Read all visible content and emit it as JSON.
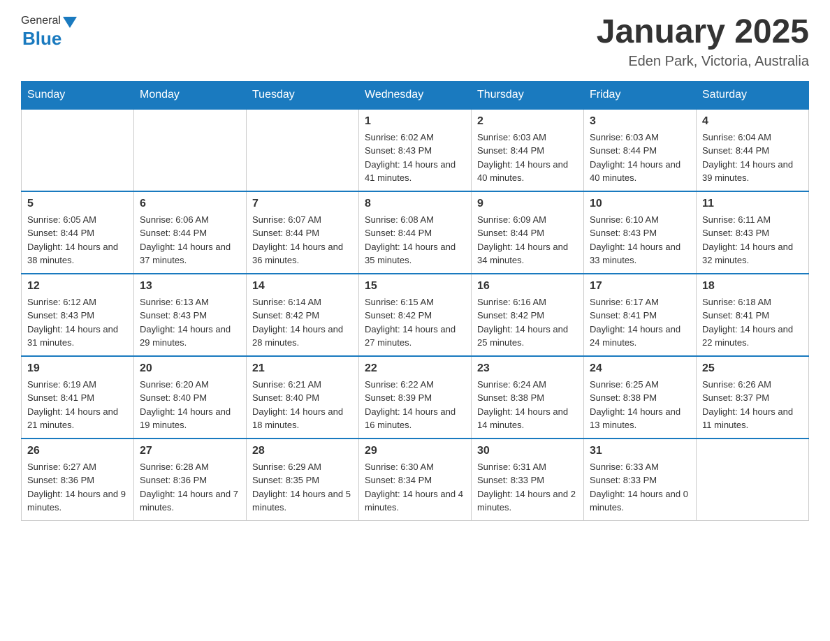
{
  "header": {
    "logo_general": "General",
    "logo_blue": "Blue",
    "month_title": "January 2025",
    "location": "Eden Park, Victoria, Australia"
  },
  "days_of_week": [
    "Sunday",
    "Monday",
    "Tuesday",
    "Wednesday",
    "Thursday",
    "Friday",
    "Saturday"
  ],
  "weeks": [
    [
      {
        "num": "",
        "info": ""
      },
      {
        "num": "",
        "info": ""
      },
      {
        "num": "",
        "info": ""
      },
      {
        "num": "1",
        "info": "Sunrise: 6:02 AM\nSunset: 8:43 PM\nDaylight: 14 hours and 41 minutes."
      },
      {
        "num": "2",
        "info": "Sunrise: 6:03 AM\nSunset: 8:44 PM\nDaylight: 14 hours and 40 minutes."
      },
      {
        "num": "3",
        "info": "Sunrise: 6:03 AM\nSunset: 8:44 PM\nDaylight: 14 hours and 40 minutes."
      },
      {
        "num": "4",
        "info": "Sunrise: 6:04 AM\nSunset: 8:44 PM\nDaylight: 14 hours and 39 minutes."
      }
    ],
    [
      {
        "num": "5",
        "info": "Sunrise: 6:05 AM\nSunset: 8:44 PM\nDaylight: 14 hours and 38 minutes."
      },
      {
        "num": "6",
        "info": "Sunrise: 6:06 AM\nSunset: 8:44 PM\nDaylight: 14 hours and 37 minutes."
      },
      {
        "num": "7",
        "info": "Sunrise: 6:07 AM\nSunset: 8:44 PM\nDaylight: 14 hours and 36 minutes."
      },
      {
        "num": "8",
        "info": "Sunrise: 6:08 AM\nSunset: 8:44 PM\nDaylight: 14 hours and 35 minutes."
      },
      {
        "num": "9",
        "info": "Sunrise: 6:09 AM\nSunset: 8:44 PM\nDaylight: 14 hours and 34 minutes."
      },
      {
        "num": "10",
        "info": "Sunrise: 6:10 AM\nSunset: 8:43 PM\nDaylight: 14 hours and 33 minutes."
      },
      {
        "num": "11",
        "info": "Sunrise: 6:11 AM\nSunset: 8:43 PM\nDaylight: 14 hours and 32 minutes."
      }
    ],
    [
      {
        "num": "12",
        "info": "Sunrise: 6:12 AM\nSunset: 8:43 PM\nDaylight: 14 hours and 31 minutes."
      },
      {
        "num": "13",
        "info": "Sunrise: 6:13 AM\nSunset: 8:43 PM\nDaylight: 14 hours and 29 minutes."
      },
      {
        "num": "14",
        "info": "Sunrise: 6:14 AM\nSunset: 8:42 PM\nDaylight: 14 hours and 28 minutes."
      },
      {
        "num": "15",
        "info": "Sunrise: 6:15 AM\nSunset: 8:42 PM\nDaylight: 14 hours and 27 minutes."
      },
      {
        "num": "16",
        "info": "Sunrise: 6:16 AM\nSunset: 8:42 PM\nDaylight: 14 hours and 25 minutes."
      },
      {
        "num": "17",
        "info": "Sunrise: 6:17 AM\nSunset: 8:41 PM\nDaylight: 14 hours and 24 minutes."
      },
      {
        "num": "18",
        "info": "Sunrise: 6:18 AM\nSunset: 8:41 PM\nDaylight: 14 hours and 22 minutes."
      }
    ],
    [
      {
        "num": "19",
        "info": "Sunrise: 6:19 AM\nSunset: 8:41 PM\nDaylight: 14 hours and 21 minutes."
      },
      {
        "num": "20",
        "info": "Sunrise: 6:20 AM\nSunset: 8:40 PM\nDaylight: 14 hours and 19 minutes."
      },
      {
        "num": "21",
        "info": "Sunrise: 6:21 AM\nSunset: 8:40 PM\nDaylight: 14 hours and 18 minutes."
      },
      {
        "num": "22",
        "info": "Sunrise: 6:22 AM\nSunset: 8:39 PM\nDaylight: 14 hours and 16 minutes."
      },
      {
        "num": "23",
        "info": "Sunrise: 6:24 AM\nSunset: 8:38 PM\nDaylight: 14 hours and 14 minutes."
      },
      {
        "num": "24",
        "info": "Sunrise: 6:25 AM\nSunset: 8:38 PM\nDaylight: 14 hours and 13 minutes."
      },
      {
        "num": "25",
        "info": "Sunrise: 6:26 AM\nSunset: 8:37 PM\nDaylight: 14 hours and 11 minutes."
      }
    ],
    [
      {
        "num": "26",
        "info": "Sunrise: 6:27 AM\nSunset: 8:36 PM\nDaylight: 14 hours and 9 minutes."
      },
      {
        "num": "27",
        "info": "Sunrise: 6:28 AM\nSunset: 8:36 PM\nDaylight: 14 hours and 7 minutes."
      },
      {
        "num": "28",
        "info": "Sunrise: 6:29 AM\nSunset: 8:35 PM\nDaylight: 14 hours and 5 minutes."
      },
      {
        "num": "29",
        "info": "Sunrise: 6:30 AM\nSunset: 8:34 PM\nDaylight: 14 hours and 4 minutes."
      },
      {
        "num": "30",
        "info": "Sunrise: 6:31 AM\nSunset: 8:33 PM\nDaylight: 14 hours and 2 minutes."
      },
      {
        "num": "31",
        "info": "Sunrise: 6:33 AM\nSunset: 8:33 PM\nDaylight: 14 hours and 0 minutes."
      },
      {
        "num": "",
        "info": ""
      }
    ]
  ]
}
